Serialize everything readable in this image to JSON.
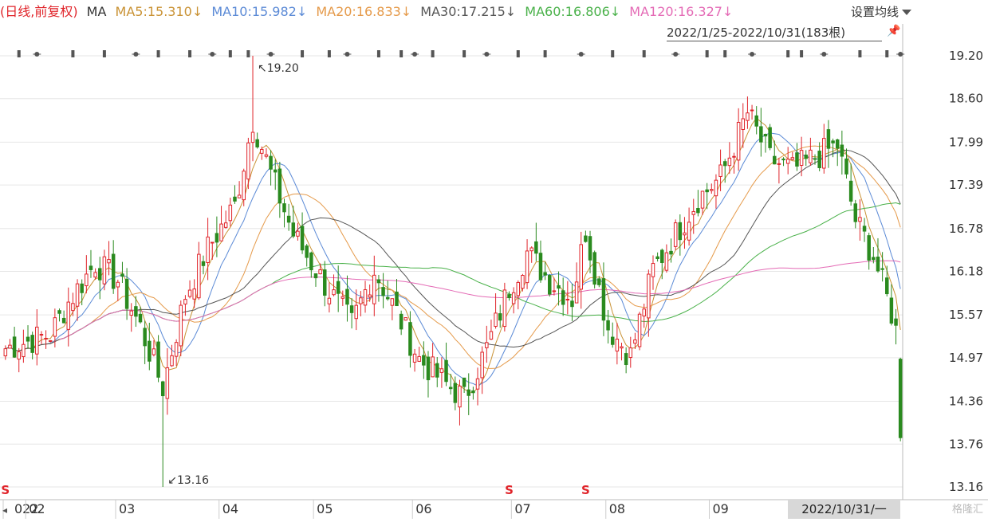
{
  "header": {
    "mode": "(日线,前复权)",
    "ma_label": "MA",
    "ma_items": [
      {
        "text": "MA5:15.310↓",
        "color": "#c99234"
      },
      {
        "text": "MA10:15.982↓",
        "color": "#5b8ad6"
      },
      {
        "text": "MA20:16.833↓",
        "color": "#e59a4a"
      },
      {
        "text": "MA30:17.215↓",
        "color": "#555555"
      },
      {
        "text": "MA60:16.806↓",
        "color": "#49b149"
      },
      {
        "text": "MA120:16.327↓",
        "color": "#e46ab5"
      }
    ],
    "settings_label": "设置均线",
    "range_label": "2022/1/25-2022/10/31(183根)"
  },
  "watermark": "格隆汇",
  "chart_data": {
    "type": "candlestick",
    "period": "2022/1/25-2022/10/31",
    "bar_count": 183,
    "y_ticks": [
      19.2,
      18.6,
      17.99,
      17.39,
      16.78,
      16.18,
      15.57,
      14.97,
      14.36,
      13.76,
      13.16
    ],
    "ylim": [
      13.16,
      19.2
    ],
    "x_ticks": [
      "022",
      "02",
      "03",
      "04",
      "05",
      "06",
      "07",
      "08",
      "09"
    ],
    "current_date_label": "2022/10/31/一",
    "annotations": [
      {
        "text": "19.20",
        "kind": "high",
        "value": 19.2,
        "date": "2022-04-12"
      },
      {
        "text": "13.16",
        "kind": "low",
        "value": 13.16,
        "date": "2022-03-15"
      }
    ],
    "s_markers": [
      "2022-01-25",
      "2022-06-30",
      "2022-07-25"
    ],
    "colors": {
      "up": "#e0242a",
      "down": "#2a8a1f",
      "grid": "#e6e6e6"
    },
    "series": [
      {
        "name": "MA5",
        "color": "#c99234",
        "last": 15.31
      },
      {
        "name": "MA10",
        "color": "#5b8ad6",
        "last": 15.982
      },
      {
        "name": "MA20",
        "color": "#e59a4a",
        "last": 16.833
      },
      {
        "name": "MA30",
        "color": "#555555",
        "last": 17.215
      },
      {
        "name": "MA60",
        "color": "#49b149",
        "last": 16.806
      },
      {
        "name": "MA120",
        "color": "#e46ab5",
        "last": 16.327
      }
    ],
    "anchors": [
      [
        "2022-01-25",
        15.1
      ],
      [
        "2022-02-08",
        15.3
      ],
      [
        "2022-02-14",
        15.75
      ],
      [
        "2022-02-22",
        16.3
      ],
      [
        "2022-03-01",
        16.05
      ],
      [
        "2022-03-08",
        15.4
      ],
      [
        "2022-03-15",
        14.55
      ],
      [
        "2022-03-22",
        15.85
      ],
      [
        "2022-03-29",
        16.5
      ],
      [
        "2022-04-06",
        17.1
      ],
      [
        "2022-04-12",
        18.3
      ],
      [
        "2022-04-18",
        17.55
      ],
      [
        "2022-04-25",
        16.7
      ],
      [
        "2022-05-05",
        15.9
      ],
      [
        "2022-05-12",
        15.45
      ],
      [
        "2022-05-19",
        16.2
      ],
      [
        "2022-05-26",
        15.6
      ],
      [
        "2022-06-02",
        14.95
      ],
      [
        "2022-06-10",
        14.6
      ],
      [
        "2022-06-16",
        14.4
      ],
      [
        "2022-06-23",
        15.1
      ],
      [
        "2022-06-30",
        15.95
      ],
      [
        "2022-07-06",
        16.45
      ],
      [
        "2022-07-13",
        16.05
      ],
      [
        "2022-07-20",
        15.8
      ],
      [
        "2022-07-25",
        16.75
      ],
      [
        "2022-08-01",
        15.4
      ],
      [
        "2022-08-08",
        15.0
      ],
      [
        "2022-08-15",
        16.2
      ],
      [
        "2022-08-22",
        16.7
      ],
      [
        "2022-08-29",
        17.2
      ],
      [
        "2022-09-05",
        17.5
      ],
      [
        "2022-09-13",
        18.4
      ],
      [
        "2022-09-20",
        17.75
      ],
      [
        "2022-09-27",
        17.6
      ],
      [
        "2022-10-11",
        17.95
      ],
      [
        "2022-10-17",
        16.9
      ],
      [
        "2022-10-21",
        16.4
      ],
      [
        "2022-10-27",
        15.6
      ],
      [
        "2022-10-28",
        15.35
      ],
      [
        "2022-10-31",
        13.85
      ]
    ]
  }
}
